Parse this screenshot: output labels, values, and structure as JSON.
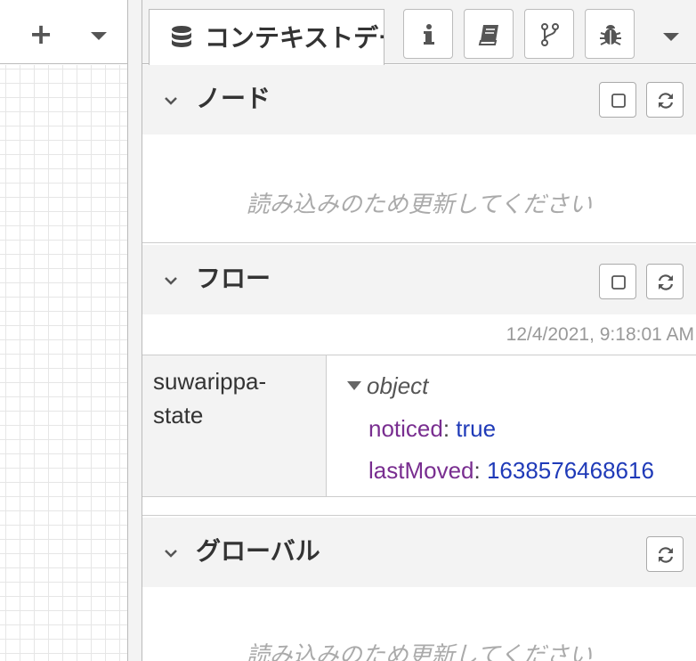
{
  "workspace": {
    "add_label": "+"
  },
  "sidebar": {
    "active_tab": {
      "label": "コンテキストデータ",
      "icon": "database-icon"
    },
    "tab_buttons": [
      {
        "name": "info-icon"
      },
      {
        "name": "book-icon"
      },
      {
        "name": "branch-icon"
      },
      {
        "name": "bug-icon"
      }
    ],
    "sections": {
      "node": {
        "title": "ノード",
        "placeholder": "読み込みのため更新してください"
      },
      "flow": {
        "title": "フロー",
        "timestamp": "12/4/2021, 9:18:01 AM",
        "entry": {
          "key": "suwarippa-state",
          "type": "object",
          "props": [
            {
              "key": "noticed",
              "value": "true"
            },
            {
              "key": "lastMoved",
              "value": "1638576468616"
            }
          ]
        }
      },
      "global": {
        "title": "グローバル",
        "placeholder": "読み込みのため更新してください"
      }
    }
  },
  "colors": {
    "prop_key": "#792e90",
    "prop_value": "#1f3ab8",
    "header_bg": "#f3f3f3"
  }
}
